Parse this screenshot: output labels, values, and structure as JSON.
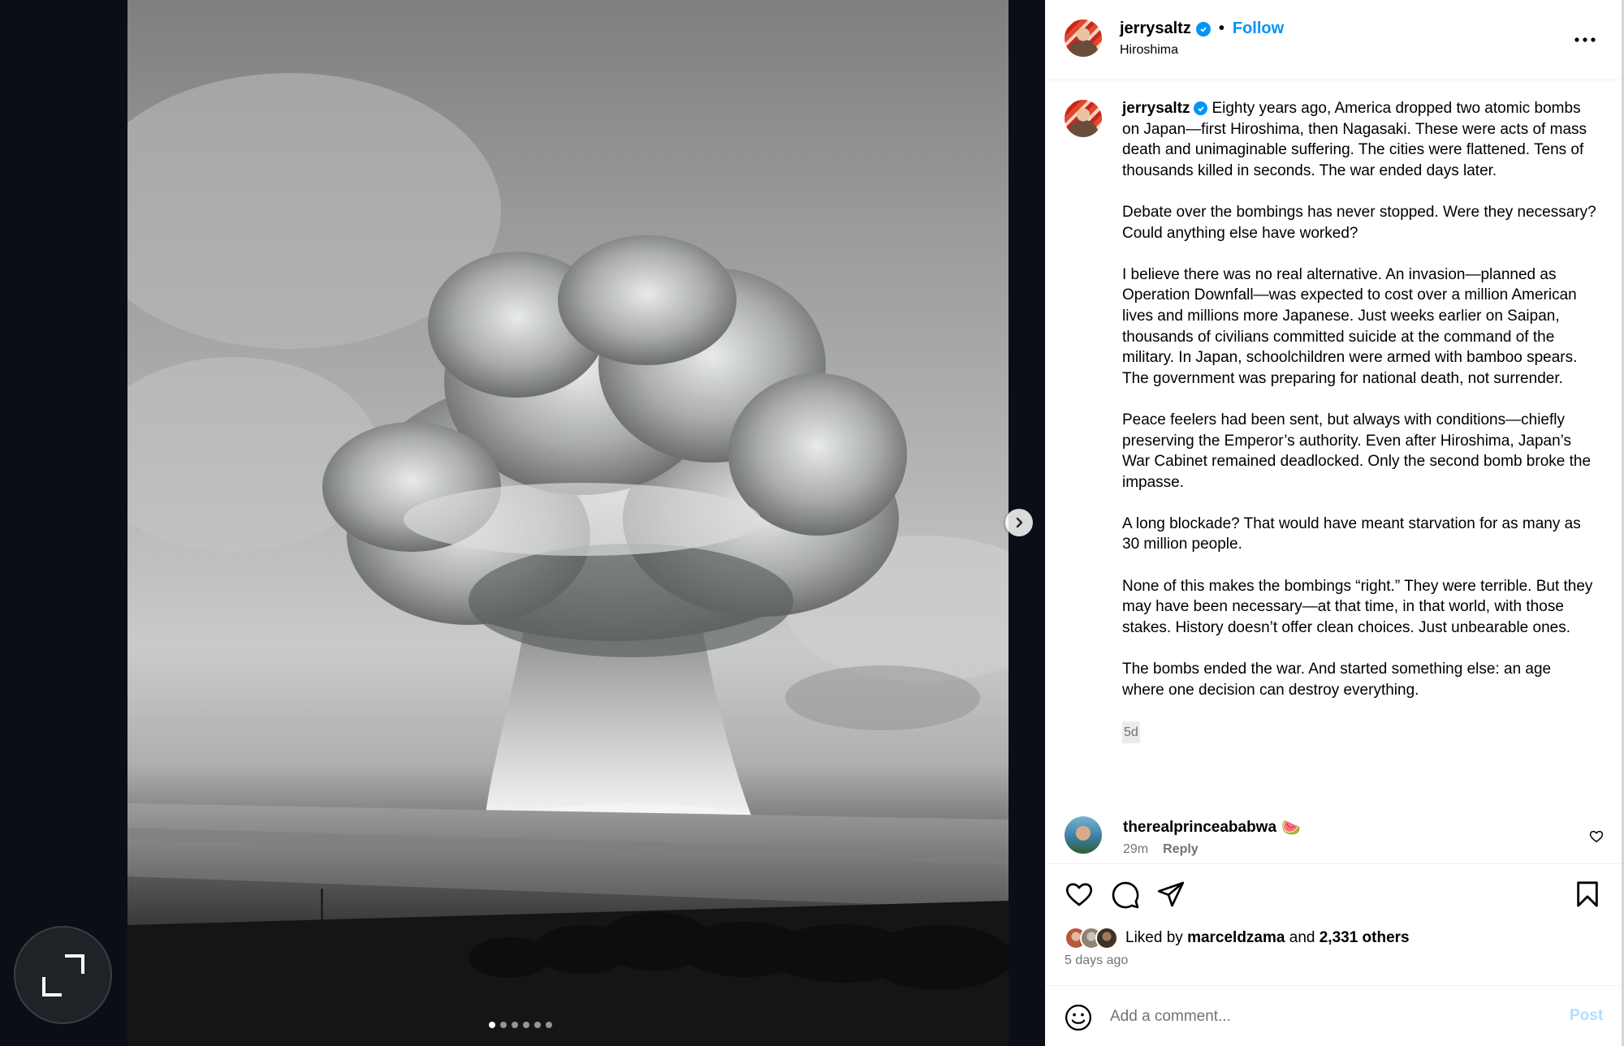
{
  "post": {
    "username": "jerrysaltz",
    "follow_label": "Follow",
    "separator": "•",
    "location": "Hiroshima",
    "more_label": "More options"
  },
  "media": {
    "alt": "Black and white photo of a mushroom cloud rising over water with palm trees in the foreground",
    "slide_count": 6,
    "active_slide": 1
  },
  "caption": {
    "username": "jerrysaltz",
    "paragraphs": [
      "Eighty years ago, America dropped two atomic bombs on Japan—first Hiroshima, then Nagasaki. These were acts of mass death and unimaginable suffering. The cities were flattened. Tens of thousands killed in seconds. The war ended days later.",
      "Debate over the bombings has never stopped. Were they necessary? Could anything else have worked?",
      "I believe there was no real alternative. An invasion—planned as Operation Downfall—was expected to cost over a million American lives and millions more Japanese. Just weeks earlier on Saipan, thousands of civilians committed suicide at the command of the military. In Japan, schoolchildren were armed with bamboo spears. The government was preparing for national death, not surrender.",
      "Peace feelers had been sent, but always with conditions—chiefly preserving the Emperor’s authority. Even after Hiroshima, Japan’s War Cabinet remained deadlocked. Only the second bomb broke the impasse.",
      "A long blockade? That would have meant starvation for as many as 30 million people.",
      "None of this makes the bombings “right.” They were terrible. But they may have been necessary—at that time, in that world, with those stakes. History doesn’t offer clean choices. Just unbearable ones.",
      "The bombs ended the war. And started something else: an age where one decision can destroy everything."
    ],
    "time": "5d"
  },
  "comment": {
    "username": "therealprinceababwa",
    "emoji": "🍉",
    "time": "29m",
    "reply_label": "Reply"
  },
  "engagement": {
    "liked_prefix": "Liked by",
    "liked_user": "marceldzama",
    "liked_and": "and",
    "liked_count": "2,331 others",
    "posted_ago": "5 days ago"
  },
  "composer": {
    "placeholder": "Add a comment...",
    "post_label": "Post"
  },
  "colors": {
    "accent": "#0095f6",
    "post_disabled": "#b3dbff",
    "secondary_text": "#737373"
  },
  "icons": [
    "verified-badge-icon",
    "more-icon",
    "chevron-right-icon",
    "expand-icon",
    "heart-icon",
    "comment-icon",
    "share-icon",
    "bookmark-icon",
    "emoji-icon"
  ]
}
